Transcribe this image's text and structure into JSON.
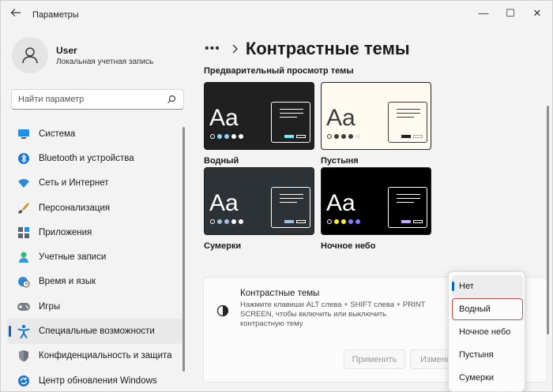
{
  "window": {
    "title": "Параметры",
    "controls": {
      "minimize": "—",
      "maximize": "☐",
      "close": "✕"
    }
  },
  "user": {
    "name": "User",
    "account_type": "Локальная учетная запись"
  },
  "search": {
    "placeholder": "Найти параметр"
  },
  "sidebar": {
    "items": [
      {
        "label": "Система",
        "icon": "monitor-icon"
      },
      {
        "label": "Bluetooth и устройства",
        "icon": "bluetooth-icon"
      },
      {
        "label": "Сеть и Интернет",
        "icon": "wifi-icon"
      },
      {
        "label": "Персонализация",
        "icon": "brush-icon"
      },
      {
        "label": "Приложения",
        "icon": "apps-icon"
      },
      {
        "label": "Учетные записи",
        "icon": "person-icon"
      },
      {
        "label": "Время и язык",
        "icon": "globe-clock-icon"
      },
      {
        "label": "Игры",
        "icon": "gamepad-icon"
      },
      {
        "label": "Специальные возможности",
        "icon": "accessibility-icon",
        "active": true
      },
      {
        "label": "Конфиденциальность и защита",
        "icon": "shield-icon"
      },
      {
        "label": "Центр обновления Windows",
        "icon": "update-icon"
      }
    ],
    "accent_color": "#0067c0"
  },
  "header": {
    "breadcrumb_more": "•••",
    "title": "Контрастные темы"
  },
  "preview": {
    "label": "Предварительный просмотр темы",
    "sample_text": "Aa",
    "themes": [
      {
        "name": "Водный",
        "bg": "#202020",
        "fg": "#ffffff",
        "selected": true,
        "dots": [
          "#ffffff",
          "#8fd4ff",
          "#8fd4ff",
          "#ffffff",
          "#ffffff"
        ],
        "btn1": "#75e9fc",
        "btn2": "#ffffff"
      },
      {
        "name": "Пустыня",
        "bg": "#fffaef",
        "fg": "#3d3d3d",
        "selected": false,
        "dots": [
          "#3d3d3d",
          "#3d3d3d",
          "#3d3d3d",
          "#3d3d3d",
          "#e5e5e5"
        ],
        "btn1": "#202020",
        "btn2": "#aaaaaa"
      },
      {
        "name": "Сумерки",
        "bg": "#2d3236",
        "fg": "#ffffff",
        "selected": false,
        "dots": [
          "#ffffff",
          "#a1bfde",
          "#a1bfde",
          "#ffffff",
          "#ffffff"
        ],
        "btn1": "#a1bfde",
        "btn2": "#ffffff"
      },
      {
        "name": "Ночное небо",
        "bg": "#000000",
        "fg": "#ffffff",
        "selected": false,
        "dots": [
          "#ffffff",
          "#ffee32",
          "#ffee32",
          "#8080ff",
          "#8080ff"
        ],
        "btn1": "#c6a6ff",
        "btn2": "#ffffff"
      }
    ]
  },
  "contrast": {
    "title": "Контрастные темы",
    "description": "Нажмите клавиши ALT слева + SHIFT слева + PRINT SCREEN, чтобы включить или выключить контрастную тему",
    "apply_label": "Применить",
    "edit_label": "Изменить"
  },
  "dropdown": {
    "options": [
      "Нет",
      "Водный",
      "Ночное небо",
      "Пустыня",
      "Сумерки"
    ],
    "selected": "Нет",
    "highlighted": "Водный"
  }
}
